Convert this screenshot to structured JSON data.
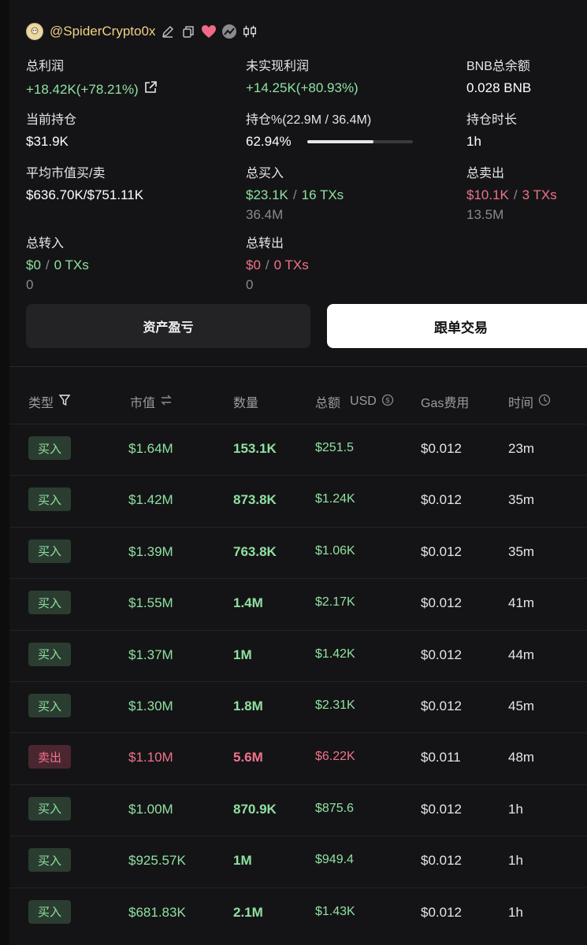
{
  "profile": {
    "handle": "@SpiderCrypto0x",
    "avatar_icon": "avatar-icon",
    "icons": [
      "edit-icon",
      "copy-icon",
      "heart-icon",
      "chart-icon",
      "candlestick-icon"
    ]
  },
  "stats": {
    "total_profit": {
      "label": "总利润",
      "value": "+18.42K(+78.21%)"
    },
    "unrealized_profit": {
      "label": "未实现利润",
      "value": "+14.25K(+80.93%)"
    },
    "bnb_balance": {
      "label": "BNB总余额",
      "value": "0.028 BNB"
    },
    "current_position": {
      "label": "当前持仓",
      "value": "$31.9K"
    },
    "position_pct": {
      "label": "持仓%(22.9M / 36.4M)",
      "value": "62.94%",
      "progress": 0.6294
    },
    "holding_duration": {
      "label": "持仓时长",
      "value": "1h"
    },
    "avg_mcap": {
      "label": "平均市值买/卖",
      "value": "$636.70K/$751.11K"
    },
    "total_buy": {
      "label": "总买入",
      "amount": "$23.1K",
      "sep": "/",
      "txs": "16 TXs",
      "sub": "36.4M"
    },
    "total_sell": {
      "label": "总卖出",
      "amount": "$10.1K",
      "sep": "/",
      "txs": "3 TXs",
      "sub": "13.5M"
    },
    "total_transfer_in": {
      "label": "总转入",
      "amount": "$0",
      "sep": "/",
      "txs": "0 TXs",
      "sub": "0"
    },
    "total_transfer_out": {
      "label": "总转出",
      "amount": "$0",
      "sep": "/",
      "txs": "0 TXs",
      "sub": "0"
    }
  },
  "buttons": {
    "assets_pnl": "资产盈亏",
    "copy_trade": "跟单交易"
  },
  "table": {
    "headers": {
      "type": "类型",
      "mcap": "市值",
      "qty": "数量",
      "total": "总额",
      "total_unit": "USD",
      "gas": "Gas费用",
      "time": "时间"
    },
    "rows": [
      {
        "type": "买入",
        "side": "buy",
        "mcap": "$1.64M",
        "qty": "153.1K",
        "total": "$251.5",
        "gas": "$0.012",
        "time": "23m"
      },
      {
        "type": "买入",
        "side": "buy",
        "mcap": "$1.42M",
        "qty": "873.8K",
        "total": "$1.24K",
        "gas": "$0.012",
        "time": "35m"
      },
      {
        "type": "买入",
        "side": "buy",
        "mcap": "$1.39M",
        "qty": "763.8K",
        "total": "$1.06K",
        "gas": "$0.012",
        "time": "35m"
      },
      {
        "type": "买入",
        "side": "buy",
        "mcap": "$1.55M",
        "qty": "1.4M",
        "total": "$2.17K",
        "gas": "$0.012",
        "time": "41m"
      },
      {
        "type": "买入",
        "side": "buy",
        "mcap": "$1.37M",
        "qty": "1M",
        "total": "$1.42K",
        "gas": "$0.012",
        "time": "44m"
      },
      {
        "type": "买入",
        "side": "buy",
        "mcap": "$1.30M",
        "qty": "1.8M",
        "total": "$2.31K",
        "gas": "$0.012",
        "time": "45m"
      },
      {
        "type": "卖出",
        "side": "sell",
        "mcap": "$1.10M",
        "qty": "5.6M",
        "total": "$6.22K",
        "gas": "$0.011",
        "time": "48m"
      },
      {
        "type": "买入",
        "side": "buy",
        "mcap": "$1.00M",
        "qty": "870.9K",
        "total": "$875.6",
        "gas": "$0.012",
        "time": "1h"
      },
      {
        "type": "买入",
        "side": "buy",
        "mcap": "$925.57K",
        "qty": "1M",
        "total": "$949.4",
        "gas": "$0.012",
        "time": "1h"
      },
      {
        "type": "买入",
        "side": "buy",
        "mcap": "$681.83K",
        "qty": "2.1M",
        "total": "$1.43K",
        "gas": "$0.012",
        "time": "1h"
      }
    ]
  },
  "colors": {
    "buy": "#8fe0a1",
    "sell": "#f0738a",
    "handle": "#f0cf85",
    "background": "#141416"
  }
}
